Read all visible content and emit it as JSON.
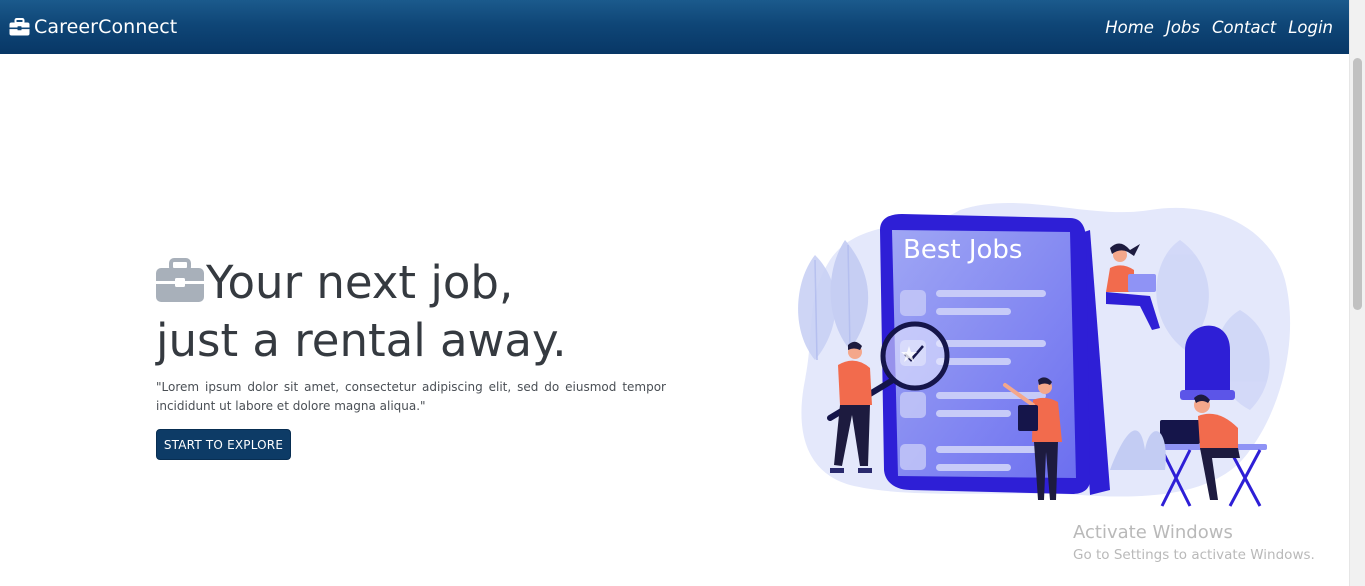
{
  "navbar": {
    "brand": "CareerConnect",
    "brand_icon": "briefcase-icon",
    "links": [
      "Home",
      "Jobs",
      "Contact",
      "Login"
    ],
    "colors": {
      "background": "#0f4677",
      "text": "#ffffff"
    }
  },
  "hero": {
    "title_icon": "briefcase-icon",
    "title_line1": "Your next job,",
    "title_line2": "just a rental away.",
    "description": "\"Lorem ipsum dolor sit amet, consectetur adipiscing elit, sed do eiusmod tempor incididunt ut labore et dolore magna aliqua.\"",
    "cta_label": "START TO EXPLORE",
    "colors": {
      "title": "#353a40",
      "cta": "#0d3b66"
    }
  },
  "illustration": {
    "heading": "Best Jobs",
    "accent": "#2e1fd6"
  },
  "watermark": {
    "title": "Activate Windows",
    "subtitle": "Go to Settings to activate Windows."
  }
}
